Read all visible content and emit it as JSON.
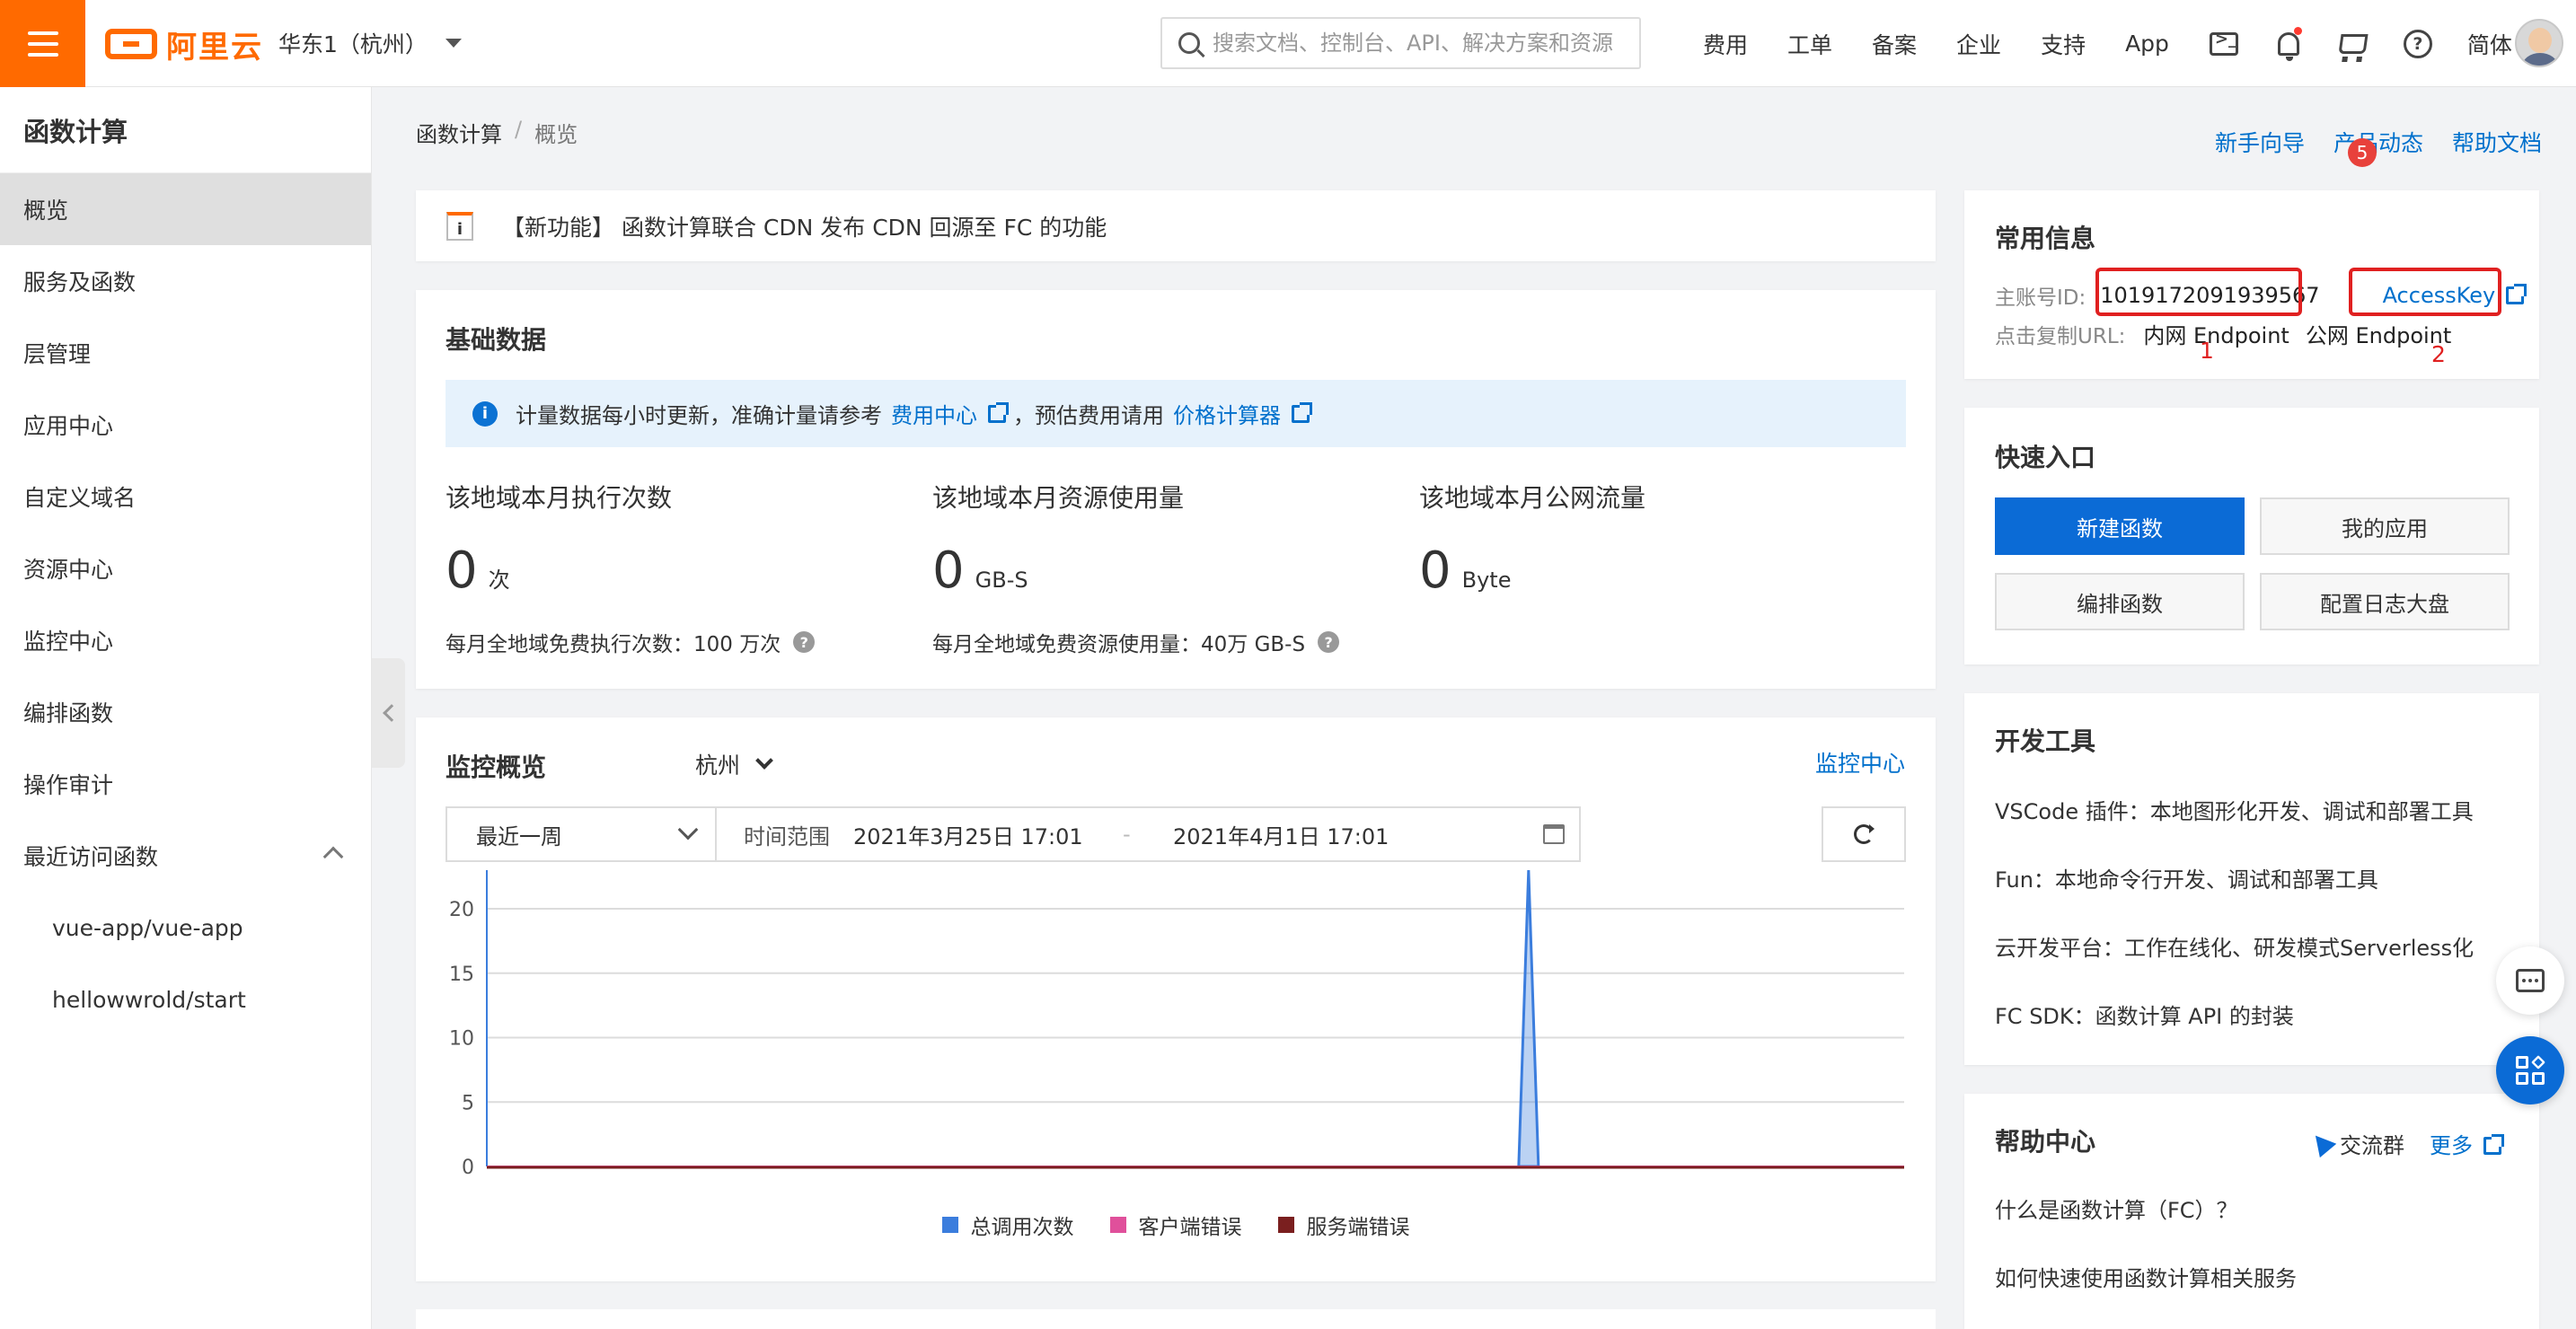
{
  "header": {
    "logo_text": "阿里云",
    "region": "华东1（杭州）",
    "search_placeholder": "搜索文档、控制台、API、解决方案和资源",
    "nav": [
      "费用",
      "工单",
      "备案",
      "企业",
      "支持",
      "App"
    ],
    "language": "简体"
  },
  "sidebar": {
    "title": "函数计算",
    "items": [
      {
        "label": "概览",
        "active": true
      },
      {
        "label": "服务及函数"
      },
      {
        "label": "层管理"
      },
      {
        "label": "应用中心"
      },
      {
        "label": "自定义域名"
      },
      {
        "label": "资源中心"
      },
      {
        "label": "监控中心"
      },
      {
        "label": "编排函数"
      },
      {
        "label": "操作审计"
      },
      {
        "label": "最近访问函数"
      }
    ],
    "recent": [
      "vue-app/vue-app",
      "hellowwrold/start"
    ]
  },
  "breadcrumb": {
    "root": "函数计算",
    "sep": "/",
    "current": "概览"
  },
  "top_links": {
    "guide": "新手向导",
    "news": "产品动态",
    "news_badge": "5",
    "docs": "帮助文档"
  },
  "announcement": {
    "icon": "i",
    "text": "【新功能】 函数计算联合 CDN 发布 CDN 回源至 FC 的功能"
  },
  "basic": {
    "title": "基础数据",
    "notice_prefix": "计量数据每小时更新，准确计量请参考",
    "notice_link1": "费用中心",
    "notice_mid": "，预估费用请用",
    "notice_link2": "价格计算器",
    "metrics": [
      {
        "label": "该地域本月执行次数",
        "value": "0",
        "unit": "次",
        "foot": "每月全地域免费执行次数：100 万次"
      },
      {
        "label": "该地域本月资源使用量",
        "value": "0",
        "unit": "GB-S",
        "foot": "每月全地域免费资源使用量：40万 GB-S"
      },
      {
        "label": "该地域本月公网流量",
        "value": "0",
        "unit": "Byte",
        "foot": ""
      }
    ]
  },
  "monitor": {
    "title": "监控概览",
    "region": "杭州",
    "link": "监控中心",
    "period": "最近一周",
    "range_label": "时间范围",
    "start": "2021年3月25日 17:01",
    "dash": "-",
    "end": "2021年4月1日 17:01"
  },
  "chart_data": {
    "type": "area",
    "y_ticks": [
      0,
      5,
      10,
      15,
      20
    ],
    "ylim": [
      0,
      23
    ],
    "series": [
      {
        "name": "总调用次数",
        "color": "#3b7ddd",
        "spike_position": 0.735,
        "spike_value": 23
      },
      {
        "name": "客户端错误",
        "color": "#e0509b",
        "values": "all 0"
      },
      {
        "name": "服务端错误",
        "color": "#7a1f1f",
        "values": "all 0"
      }
    ]
  },
  "info": {
    "title": "常用信息",
    "account_label": "主账号ID:",
    "account_id": "1019172091939567",
    "accesskey": "AccessKey",
    "url_label": "点击复制URL:",
    "internal": "内网 Endpoint",
    "public": "公网 Endpoint",
    "marker1": "1",
    "marker2": "2"
  },
  "quick": {
    "title": "快速入口",
    "buttons": [
      "新建函数",
      "我的应用",
      "编排函数",
      "配置日志大盘"
    ]
  },
  "dev": {
    "title": "开发工具",
    "items": [
      "VSCode 插件：本地图形化开发、调试和部署工具",
      "Fun：本地命令行开发、调试和部署工具",
      "云开发平台：工作在线化、研发模式Serverless化",
      "FC SDK：函数计算 API 的封装"
    ]
  },
  "help": {
    "title": "帮助中心",
    "group": "交流群",
    "more": "更多",
    "items": [
      "什么是函数计算（FC）？",
      "如何快速使用函数计算相关服务"
    ]
  }
}
